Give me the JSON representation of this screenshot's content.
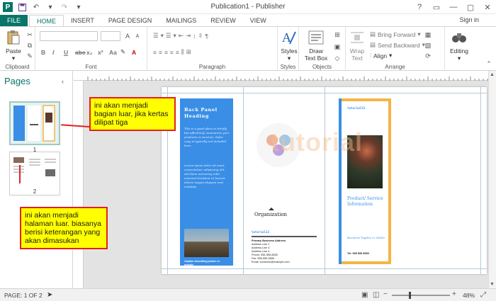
{
  "window": {
    "title": "Publication1 - Publisher",
    "controls": [
      "?",
      "□",
      "—",
      "▢",
      "✕"
    ]
  },
  "qat": {
    "save_icon": "save-icon",
    "undo_icon": "undo-icon",
    "redo_icon": "redo-icon",
    "customize_icon": "customize-icon"
  },
  "tabs": [
    {
      "label": "FILE"
    },
    {
      "label": "HOME"
    },
    {
      "label": "INSERT"
    },
    {
      "label": "PAGE DESIGN"
    },
    {
      "label": "MAILINGS"
    },
    {
      "label": "REVIEW"
    },
    {
      "label": "VIEW"
    }
  ],
  "signin": "Sign in",
  "ribbon": {
    "clipboard": {
      "label": "Clipboard",
      "paste": "Paste"
    },
    "font": {
      "label": "Font",
      "bold": "B",
      "italic": "I",
      "underline": "U"
    },
    "paragraph": {
      "label": "Paragraph"
    },
    "styles": {
      "label": "Styles",
      "btn": "Styles"
    },
    "objects": {
      "label": "Objects",
      "draw": "Draw",
      "textbox": "Text Box"
    },
    "arrange": {
      "label": "Arrange",
      "wrap": "Wrap",
      "text": "Text",
      "bring": "Bring Forward",
      "send": "Send Backward",
      "align": "Align"
    },
    "editing": {
      "label": "",
      "btn": "Editing"
    }
  },
  "pages_pane": {
    "title": "Pages",
    "thumbs": [
      {
        "num": "1"
      },
      {
        "num": "2"
      }
    ]
  },
  "brochure": {
    "back_heading": "Back Panel Heading",
    "back_body": "This is a good place to briefly, but effectively, summarize your products or services. Sales copy is typically not included here.",
    "back_body2": "Lorem ipsum dolor sit amet, consectetuer adipiscing elit, sed diam nonummy nibh euismod tincidunt ut laoreet dolore magna aliquam erat volutpat.",
    "caption": "Caption describing picture or graphic.",
    "org": "Organization",
    "tag": "tutorial21",
    "addr": [
      "Primary Business Address",
      "Address Line 2",
      "Address Line 3",
      "Address Line 4",
      "Phone: 555-555-5555",
      "Fax: 555-555-5555",
      "Email: someone@example.com"
    ],
    "cover_tag": "tutorial21",
    "cover_title": "Product/ Service Information",
    "cover_tagline": "Business Tagline or Motto",
    "cover_phone": "Tel: 555 555 5555",
    "watermark": "tutorial"
  },
  "callouts": {
    "one": "ini akan menjadi bagian luar, jika kertas dilipat tiga",
    "two": "ini akan menjadi halaman luar. biasanya berisi keterangan yang akan dimasukan"
  },
  "status": {
    "page": "PAGE: 1 OF 2",
    "zoom": "48%"
  },
  "colors": {
    "accent": "#077568",
    "brochure_blue": "#3a8ee6",
    "brochure_orange": "#f4b445",
    "callout_bg": "#ffff00",
    "callout_border": "#e22222"
  }
}
